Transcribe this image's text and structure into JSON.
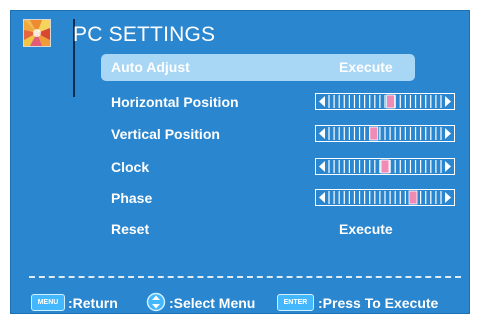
{
  "header": {
    "title": "PC SETTINGS",
    "logo_icon": "colorful-logo-icon"
  },
  "menu": {
    "items": [
      {
        "label": "Auto Adjust",
        "value": "Execute",
        "type": "action",
        "selected": true
      },
      {
        "label": "Horizontal Position",
        "type": "slider",
        "level": 0.55
      },
      {
        "label": "Vertical Position",
        "type": "slider",
        "level": 0.4
      },
      {
        "label": "Clock",
        "type": "slider",
        "level": 0.5
      },
      {
        "label": "Phase",
        "type": "slider",
        "level": 0.75
      },
      {
        "label": "Reset",
        "value": "Execute",
        "type": "action",
        "selected": false
      }
    ]
  },
  "footer": {
    "menu_key": "MENU",
    "menu_text": ":Return",
    "nav_icon": "up-down-arrows-icon",
    "nav_text": ":Select Menu",
    "enter_key": "ENTER",
    "enter_text": ":Press To Execute"
  },
  "colors": {
    "background": "#2a86cf",
    "highlight": "#a8d6f5",
    "slider_handle": "#f08bb5",
    "key_button": "#43b8ff"
  }
}
